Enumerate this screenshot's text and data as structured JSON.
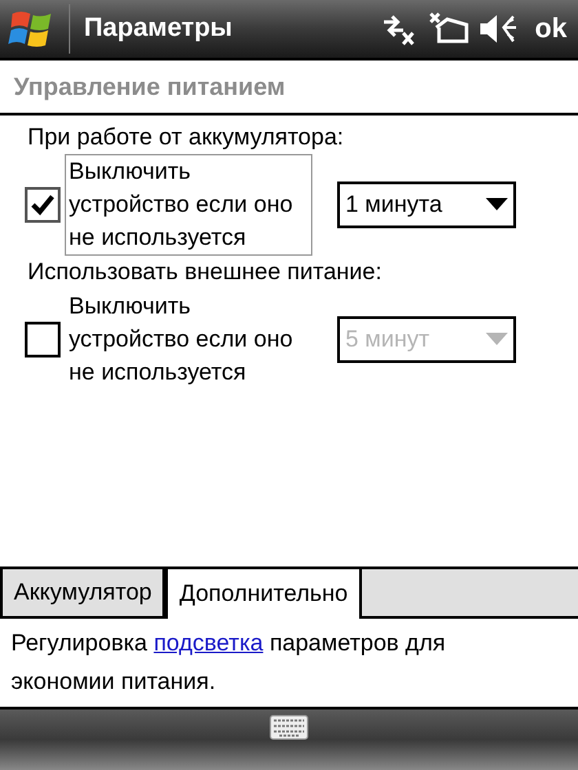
{
  "title_bar": {
    "title": "Параметры",
    "ok": "ok"
  },
  "header": "Управление питанием",
  "sections": [
    {
      "heading": "При работе от аккумулятора:",
      "option": {
        "label": "Выключить устройство если оно не используется",
        "checked": true,
        "focused": true
      },
      "dropdown": {
        "value": "1 минута",
        "disabled": false
      }
    },
    {
      "heading": "Использовать внешнее питание:",
      "option": {
        "label": "Выключить устройство если оно не используется",
        "checked": false,
        "focused": false
      },
      "dropdown": {
        "value": "5 минут",
        "disabled": true
      }
    }
  ],
  "tabs": [
    {
      "label": "Аккумулятор",
      "selected": false
    },
    {
      "label": "Дополнительно",
      "selected": true
    }
  ],
  "description": {
    "before": "Регулировка ",
    "link": "подсветка",
    "after": " параметров для экономии питания."
  }
}
